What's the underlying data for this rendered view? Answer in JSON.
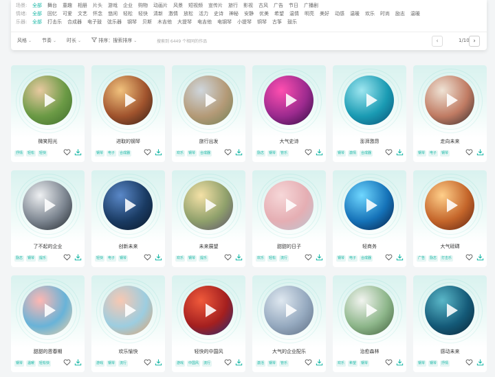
{
  "filters": {
    "scene": {
      "label": "场景:",
      "options": [
        "全部",
        "舞台",
        "童趣",
        "相册",
        "片头",
        "游戏",
        "企业",
        "购物",
        "动画片",
        "风景",
        "短视频",
        "宣传片",
        "旅行",
        "影视",
        "古风",
        "广告",
        "节日",
        "广播剧"
      ]
    },
    "mood": {
      "label": "情绪:",
      "options": [
        "全部",
        "回忆",
        "可爱",
        "文艺",
        "怀念",
        "悠闲",
        "轻松",
        "轻快",
        "清新",
        "激情",
        "放松",
        "活力",
        "史诗",
        "神秘",
        "安静",
        "优美",
        "希望",
        "温情",
        "明亮",
        "美好",
        "动感",
        "温暖",
        "欢乐",
        "时尚",
        "励志",
        "温暖"
      ]
    },
    "instrument": {
      "label": "乐器:",
      "options": [
        "全部",
        "打击乐",
        "合成器",
        "电子鼓",
        "弦乐器",
        "钢琴",
        "贝斯",
        "木吉他",
        "大提琴",
        "电吉他",
        "电钢琴",
        "小提琴",
        "铜琴",
        "古筝",
        "鼓乐"
      ]
    }
  },
  "toolbar": {
    "style": "风格",
    "beat": "节奏",
    "duration": "时长",
    "sort": "排序：搜索排序",
    "result": "搜索到 6449 个相同的作品",
    "page": "1/100",
    "prev": "‹",
    "next": "›"
  },
  "colors": {
    "accent": "#19b7a6",
    "tag_bg": "#e6f6f4"
  },
  "cards": [
    {
      "title": "微笑阳光",
      "tags": [
        "抒情",
        "轻松",
        "轻快"
      ],
      "cover": [
        "#e8c9a0",
        "#6b9a45",
        "#3e6b2c"
      ]
    },
    {
      "title": "进取的钢琴",
      "tags": [
        "钢琴",
        "电子",
        "合成器"
      ],
      "cover": [
        "#f1c27d",
        "#a0532d",
        "#2e1c16"
      ]
    },
    {
      "title": "旅行出发",
      "tags": [
        "欢乐",
        "钢琴",
        "合成器"
      ],
      "cover": [
        "#cfd6dc",
        "#b49a77",
        "#6d7f55"
      ]
    },
    {
      "title": "大气史诗",
      "tags": [
        "励志",
        "钢琴",
        "管乐"
      ],
      "cover": [
        "#ff4fb0",
        "#9b2a8e",
        "#2b0b3d"
      ]
    },
    {
      "title": "澎湃激昂",
      "tags": [
        "钢琴",
        "激情",
        "合成器"
      ],
      "cover": [
        "#9ee6f0",
        "#1a9bb3",
        "#0a4c72"
      ]
    },
    {
      "title": "走向未来",
      "tags": [
        "钢琴",
        "电子",
        "钢琴"
      ],
      "cover": [
        "#efe3d5",
        "#c07b63",
        "#2e2a2c"
      ]
    },
    {
      "title": "了不起的企业",
      "tags": [
        "励志",
        "钢琴",
        "提乐"
      ],
      "cover": [
        "#eef0f2",
        "#7c8590",
        "#20262b"
      ]
    },
    {
      "title": "创新未来",
      "tags": [
        "轻快",
        "电子",
        "钢琴"
      ],
      "cover": [
        "#5a88c8",
        "#1a3b63",
        "#0a1727"
      ]
    },
    {
      "title": "未来展望",
      "tags": [
        "欢乐",
        "钢琴",
        "提乐"
      ],
      "cover": [
        "#f4e1a6",
        "#8fa06b",
        "#5b4f6d"
      ]
    },
    {
      "title": "甜甜的日子",
      "tags": [
        "欢乐",
        "轻松",
        "流行"
      ],
      "cover": [
        "#f6d7d8",
        "#e5aeb3",
        "#b9c7d4"
      ]
    },
    {
      "title": "轻商务",
      "tags": [
        "钢琴",
        "电子",
        "合成器"
      ],
      "cover": [
        "#6fd7ff",
        "#1572b8",
        "#071b3f"
      ]
    },
    {
      "title": "大气磅礴",
      "tags": [
        "广告",
        "励志",
        "打击乐"
      ],
      "cover": [
        "#ffcf8a",
        "#c4652a",
        "#5a2112"
      ]
    },
    {
      "title": "甜甜的恩春期",
      "tags": [
        "钢琴",
        "温暖",
        "轻松快"
      ],
      "cover": [
        "#ffb7b2",
        "#68b3d8",
        "#f5d0a4"
      ]
    },
    {
      "title": "欢乐愉快",
      "tags": [
        "游戏",
        "钢琴",
        "流行"
      ],
      "cover": [
        "#f8c8b2",
        "#9ccde0",
        "#e7a067"
      ]
    },
    {
      "title": "轻快的中国风",
      "tags": [
        "游戏",
        "中国风",
        "流行"
      ],
      "cover": [
        "#f05a3b",
        "#a41f1f",
        "#1b2d7a"
      ]
    },
    {
      "title": "大气的企业配乐",
      "tags": [
        "激活",
        "钢琴",
        "管乐"
      ],
      "cover": [
        "#dfe8f0",
        "#95a9bf",
        "#5c6c80"
      ]
    },
    {
      "title": "治愈森林",
      "tags": [
        "欢乐",
        "希望",
        "钢琴"
      ],
      "cover": [
        "#f2f4f0",
        "#8db68a",
        "#3f5c3a"
      ]
    },
    {
      "title": "感动未来",
      "tags": [
        "钢琴",
        "钢琴",
        "抒情"
      ],
      "cover": [
        "#5ab7c8",
        "#145a78",
        "#0a2233"
      ]
    }
  ]
}
